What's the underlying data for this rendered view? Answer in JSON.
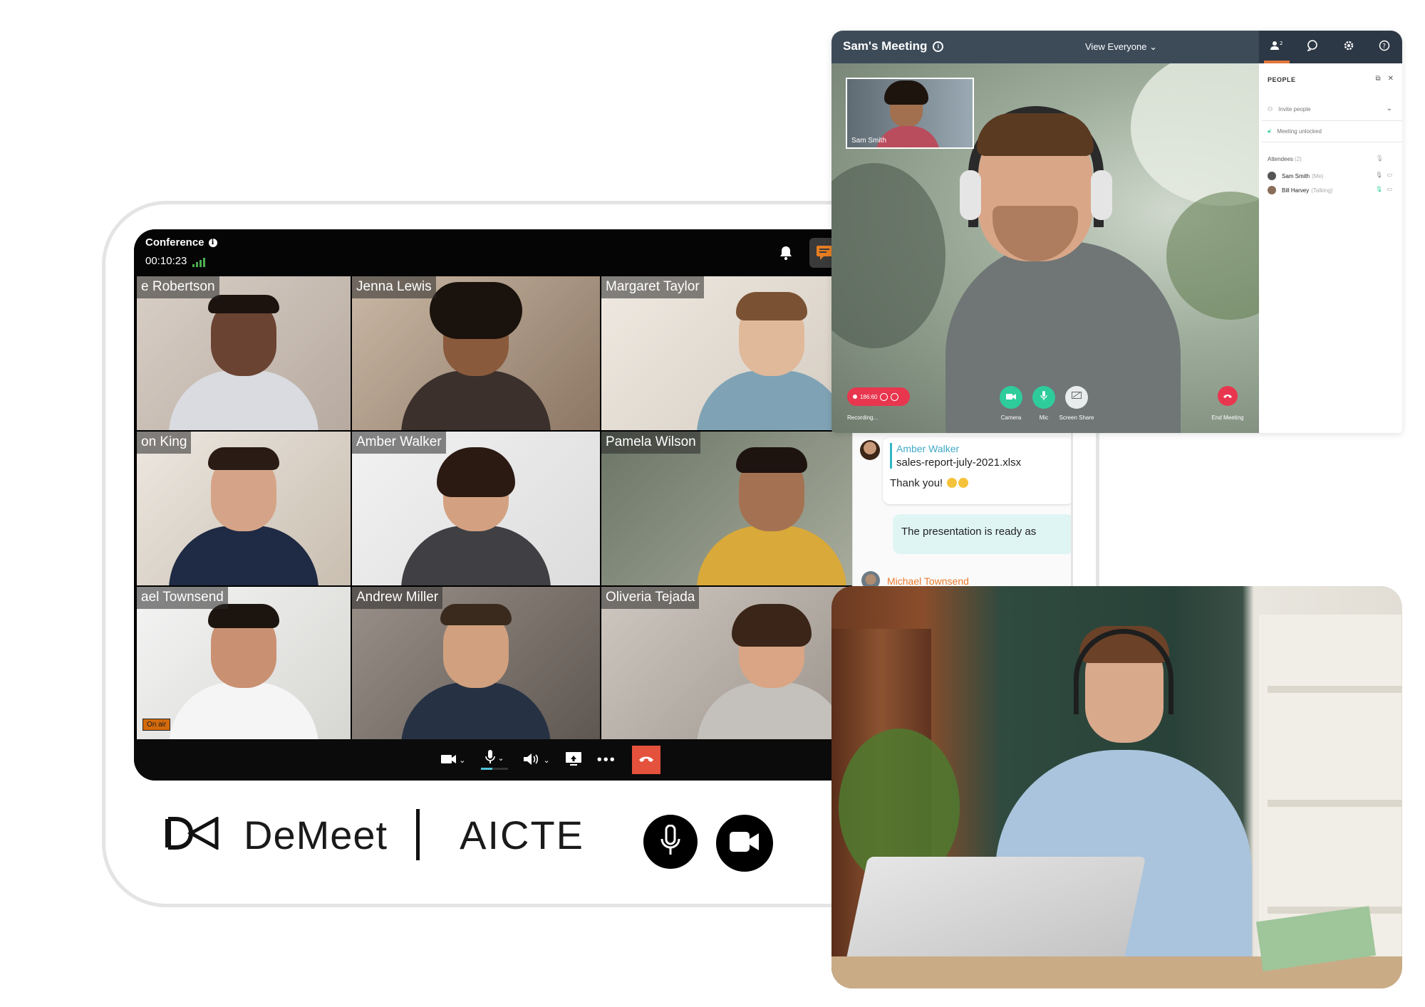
{
  "conference": {
    "title": "Conference",
    "timer": "00:10:23",
    "participants": [
      {
        "name": "e Robertson"
      },
      {
        "name": "Jenna Lewis"
      },
      {
        "name": "Margaret Taylor"
      },
      {
        "name": "on King"
      },
      {
        "name": "Amber Walker"
      },
      {
        "name": "Pamela Wilson"
      },
      {
        "name": "ael Townsend",
        "badge": "On air"
      },
      {
        "name": "Andrew Miller"
      },
      {
        "name": "Oliveria Tejada"
      }
    ],
    "header_icons": [
      "bell-icon",
      "chat-icon",
      "people-icon",
      "screen-share-icon",
      "fullscreen-icon"
    ],
    "toolbar_icons": [
      "camera-icon",
      "mic-icon",
      "speaker-icon",
      "share-screen-icon",
      "more-icon",
      "end-call-icon"
    ],
    "accent_color": "#e67e22",
    "end_call_color": "#e4513c"
  },
  "branding": {
    "product": "DeMeet",
    "partner": "AICTE"
  },
  "chat": {
    "quoted_author": "Amber Walker",
    "quoted_file": "sales-report-july-2021.xlsx",
    "message": "Thank you!",
    "reply": "The presentation is ready as",
    "next_author": "Michael Townsend"
  },
  "meeting": {
    "title": "Sam's Meeting",
    "view_label": "View Everyone",
    "self_name": "Sam Smith",
    "recording_label": "Recording...",
    "recording_time": "186:60",
    "controls": [
      "Camera",
      "Mic",
      "Screen Share"
    ],
    "end_label": "End Meeting",
    "people_panel": {
      "title": "PEOPLE",
      "invite": "Invite people",
      "lock": "Meeting unlocked",
      "attendees_label": "Attendees",
      "attendees_count": "(2)",
      "attendees": [
        {
          "name": "Sam Smith",
          "tag": "(Me)"
        },
        {
          "name": "Bill Harvey",
          "tag": "(Talking)"
        }
      ]
    }
  }
}
